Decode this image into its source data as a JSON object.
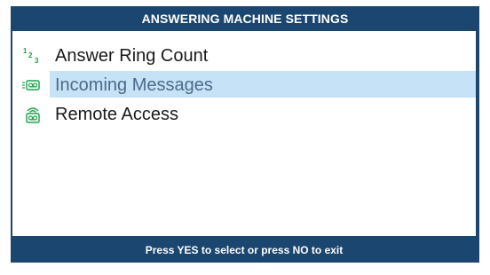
{
  "header": {
    "title": "ANSWERING MACHINE SETTINGS"
  },
  "menu": {
    "items": [
      {
        "label": "Answer Ring Count",
        "icon": "ring-count-icon",
        "selected": false
      },
      {
        "label": "Incoming Messages",
        "icon": "incoming-messages-icon",
        "selected": true
      },
      {
        "label": "Remote Access",
        "icon": "remote-access-icon",
        "selected": false
      }
    ]
  },
  "icons": {
    "ring_count": {
      "d1": "1",
      "d2": "2",
      "d3": "3"
    }
  },
  "footer": {
    "hint": "Press YES to select or press NO to exit"
  },
  "colors": {
    "frame": "#1b466f",
    "highlight": "#c6e2f6",
    "icon_green": "#1aa34a"
  }
}
